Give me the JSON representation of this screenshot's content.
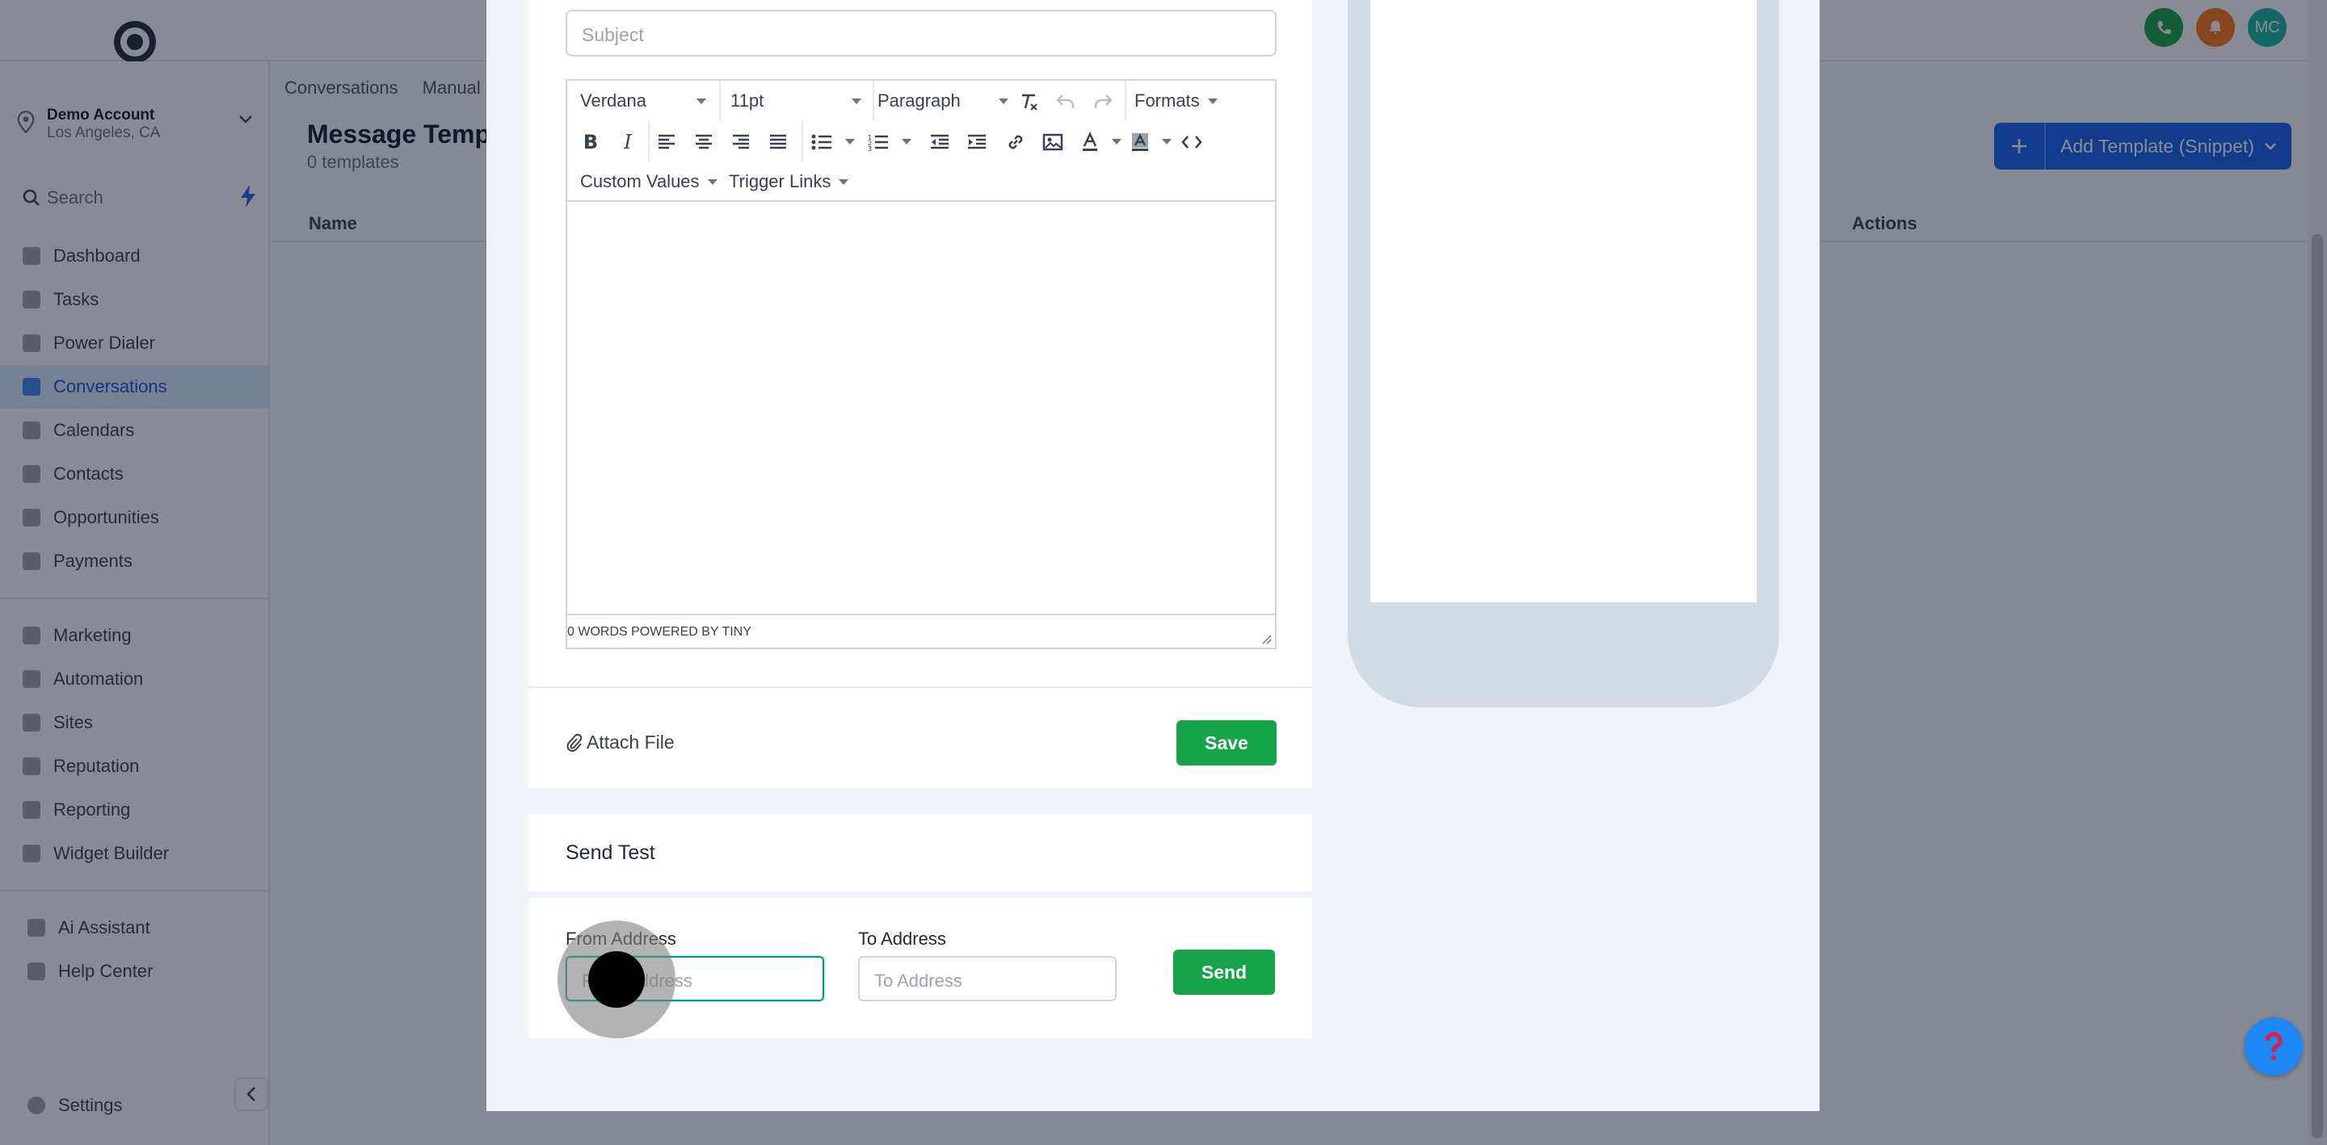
{
  "sidebar": {
    "account_name": "Demo Account",
    "account_location": "Los Angeles, CA",
    "search_label": "Search",
    "items": [
      {
        "label": "Dashboard"
      },
      {
        "label": "Tasks"
      },
      {
        "label": "Power Dialer"
      },
      {
        "label": "Conversations",
        "active": true
      },
      {
        "label": "Calendars"
      },
      {
        "label": "Contacts"
      },
      {
        "label": "Opportunities"
      },
      {
        "label": "Payments"
      }
    ],
    "items2": [
      {
        "label": "Marketing"
      },
      {
        "label": "Automation"
      },
      {
        "label": "Sites"
      },
      {
        "label": "Reputation"
      },
      {
        "label": "Reporting"
      },
      {
        "label": "Widget Builder"
      }
    ],
    "items3": [
      {
        "label": "Ai Assistant"
      },
      {
        "label": "Help Center"
      }
    ],
    "settings_label": "Settings"
  },
  "header": {
    "avatar_initials": "MC"
  },
  "main": {
    "tabs": [
      "Conversations",
      "Manual"
    ],
    "title": "Message Temp",
    "subtitle": "0 templates",
    "add_button": "Add Template (Snippet)",
    "col_name": "Name",
    "col_actions": "Actions"
  },
  "modal": {
    "subject_placeholder": "Subject",
    "editor": {
      "font_family": "Verdana",
      "font_size": "11pt",
      "block_format": "Paragraph",
      "formats_label": "Formats",
      "custom_values_label": "Custom Values",
      "trigger_links_label": "Trigger Links",
      "status": "0 WORDS POWERED BY TINY"
    },
    "attach_label": "Attach File",
    "save_label": "Save",
    "send_test_title": "Send Test",
    "from_label": "From Address",
    "from_placeholder": "From Address",
    "to_label": "To Address",
    "to_placeholder": "To Address",
    "send_label": "Send"
  },
  "colors": {
    "primary_green": "#16a34a",
    "focus_teal": "#0d9488",
    "brand_blue": "#155eef"
  }
}
